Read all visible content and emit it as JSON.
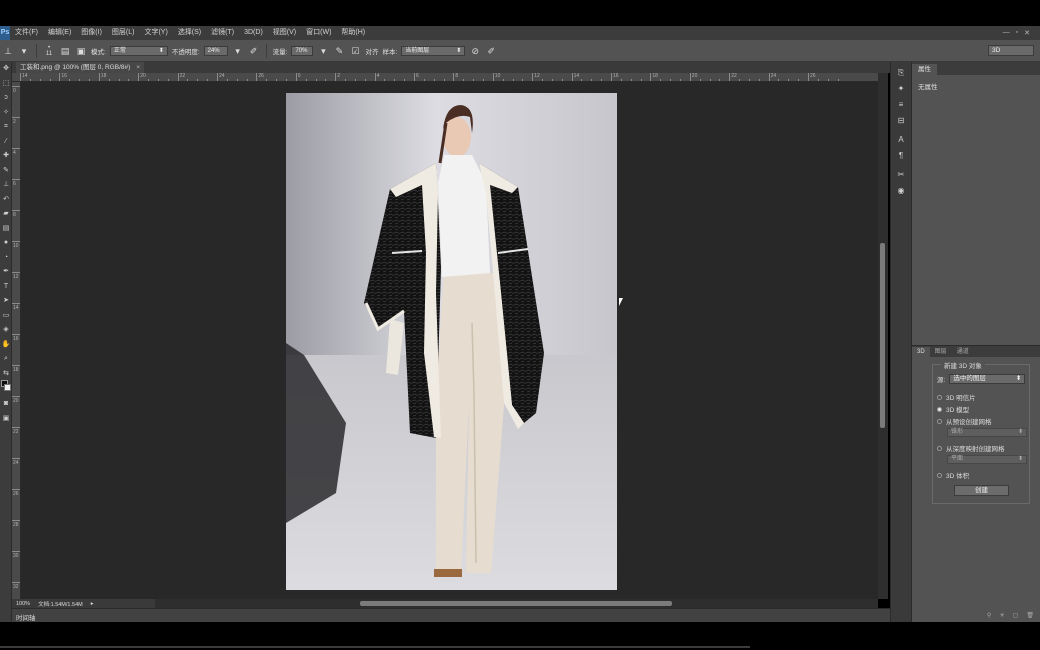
{
  "app": {
    "logo": "Ps"
  },
  "menu": [
    "文件(F)",
    "编辑(E)",
    "图像(I)",
    "图层(L)",
    "文字(Y)",
    "选择(S)",
    "滤镜(T)",
    "3D(D)",
    "视图(V)",
    "窗口(W)",
    "帮助(H)"
  ],
  "window_controls": [
    "—",
    "▫",
    "✕"
  ],
  "options": {
    "brush_size": "11",
    "mode_label": "模式:",
    "mode_value": "正常",
    "opacity_label": "不透明度:",
    "opacity_value": "24%",
    "flow_label": "流量:",
    "flow_value": "70%",
    "align_label": "对齐",
    "sample_label": "样本:",
    "sample_value": "当前图层",
    "workspace": "3D"
  },
  "document": {
    "tab_title": "工装和.png @ 100% (图层 0, RGB/8#)",
    "tab_close": "×"
  },
  "ruler": {
    "top_labels": [
      "14",
      "16",
      "18",
      "20",
      "22",
      "24",
      "26",
      "0",
      "2",
      "4",
      "6",
      "8",
      "10",
      "12",
      "14",
      "16",
      "18",
      "20",
      "22",
      "24",
      "26"
    ],
    "left_labels": [
      "0",
      "2",
      "4",
      "6",
      "8",
      "10",
      "12",
      "14",
      "16",
      "18",
      "20",
      "22",
      "24",
      "26",
      "28",
      "30",
      "32"
    ]
  },
  "status": {
    "zoom": "100%",
    "doc_info": "文档:1.54M/1.54M"
  },
  "timeline": {
    "label": "时间轴"
  },
  "panel_tabs": {
    "properties": "属性",
    "no_props": "无属性"
  },
  "lower_tabs": [
    "3D",
    "图层",
    "通道"
  ],
  "create3d": {
    "title": "新建 3D 对象",
    "source_label": "源:",
    "source_value": "选中的图层",
    "options": [
      {
        "label": "3D 明信片",
        "checked": false
      },
      {
        "label": "3D 模型",
        "checked": true
      },
      {
        "label": "从预设创建网格",
        "checked": false
      },
      {
        "label": "从深度映射创建网格",
        "checked": false
      },
      {
        "label": "3D 体积",
        "checked": false
      }
    ],
    "preset_value": "锥形",
    "depth_value": "平面",
    "create_button": "创建"
  },
  "colors": {
    "chrome": "#535353",
    "canvas_bg": "#282828",
    "coat_black": "#141414",
    "trousers_cream": "#e6ddd0"
  }
}
